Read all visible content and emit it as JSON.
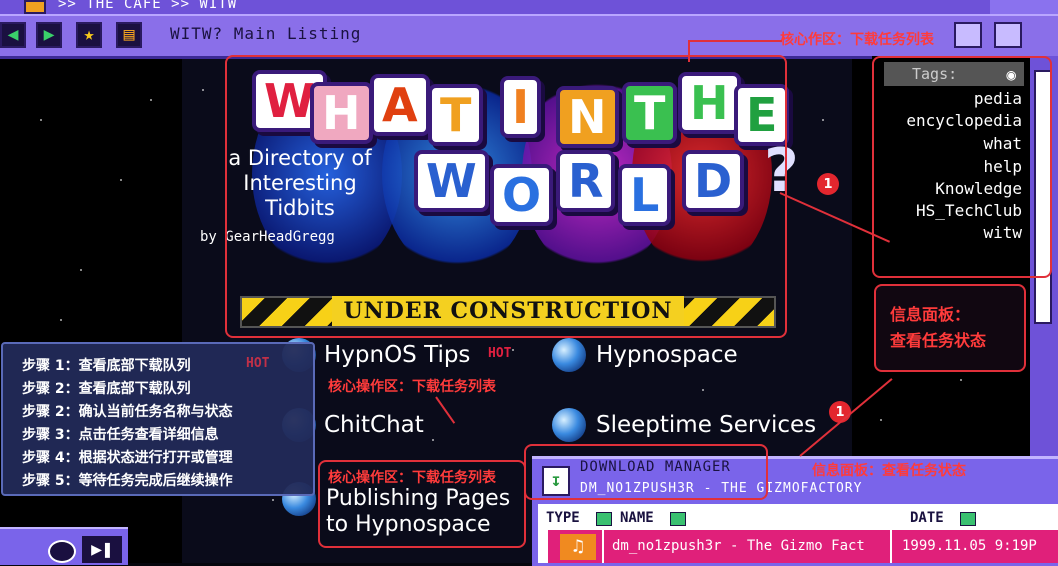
{
  "topbar": {
    "breadcrumb": ">> THE CAFE >> WITW"
  },
  "toolbar": {
    "page_title": "WITW? Main Listing"
  },
  "banner": {
    "title_line1": [
      "W",
      "H",
      "A",
      "T",
      "I",
      "N",
      "T",
      "H",
      "E"
    ],
    "title_line2": [
      "W",
      "O",
      "R",
      "L",
      "D",
      "?"
    ],
    "subtitle": "a Directory of Interesting Tidbits",
    "byline": "by GearHeadGregg",
    "construction": "UNDER CONSTRUCTION"
  },
  "links": [
    {
      "label": "HypnOS Tips",
      "badge": "HOT"
    },
    {
      "label": "Hypnospace"
    },
    {
      "label": "ChitChat"
    },
    {
      "label": "Sleeptime Services"
    },
    {
      "label": "Publishing Pages to Hypnospace"
    }
  ],
  "tags": {
    "header": "Tags:",
    "items": [
      "pedia",
      "encyclopedia",
      "what",
      "help",
      "Knowledge",
      "HS_TechClub",
      "witw"
    ]
  },
  "annotations": {
    "core_area_top": "核心作区：下载任务列表",
    "core_area_mid": "核心操作区：下载任务列表",
    "core_area_low": "核心操作区：下载任务列表",
    "info_panel": "信息面板：\n查看任务状态",
    "info_panel_inline": "信息面板：查看任务状态",
    "badge_1": "1",
    "badge_2": "1"
  },
  "steps": [
    {
      "text": "步骤 1：查看底部下载队列",
      "badge": "HOT"
    },
    {
      "text": "步骤 2：查看底部下载队列"
    },
    {
      "text": "步骤 2：确认当前任务名称与状态"
    },
    {
      "text": "步骤 3：点击任务查看详细信息"
    },
    {
      "text": "步骤 4：根据状态进行打开或管理"
    },
    {
      "text": "步骤 5：等待任务完成后继续操作"
    }
  ],
  "download_manager": {
    "title": "DOWNLOAD MANAGER",
    "current_file": "DM_NO1ZPUSH3R - THE GIZMOFACTORY",
    "columns": {
      "type": "TYPE",
      "name": "NAME",
      "date": "DATE"
    },
    "rows": [
      {
        "name": "dm_no1zpush3r - The Gizmo Fact",
        "date": "1999.11.05  9:19P"
      }
    ]
  },
  "colors": {
    "accent": "#8a6fe9",
    "annotation": "#e0303a",
    "row_highlight": "#e0207a"
  }
}
